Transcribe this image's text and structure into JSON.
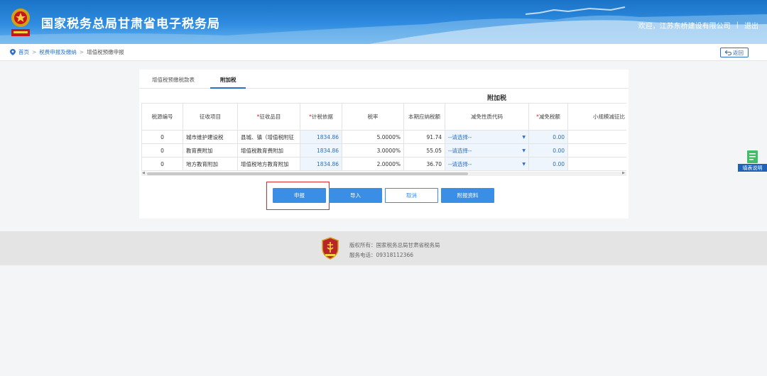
{
  "header": {
    "title": "国家税务总局甘肃省电子税务局",
    "welcome": "欢迎，江苏东桥建设有限公司",
    "separator": "|",
    "logout": "退出"
  },
  "breadcrumb": {
    "home": "首页",
    "level1": "税费申报及缴纳",
    "current": "增值税预缴申报",
    "back_label": "返回"
  },
  "tabs": [
    {
      "label": "增值税预缴税款表",
      "active": false
    },
    {
      "label": "附加税",
      "active": true
    }
  ],
  "table": {
    "group_title": "附加税",
    "columns": [
      "税源编号",
      "征收项目",
      "征收品目",
      "计税依据",
      "税率",
      "本期应纳税额",
      "减免性质代码",
      "减免税额",
      "小规模减征比"
    ],
    "required_mark": "*",
    "rows": [
      {
        "source_no": "0",
        "item": "城市维护建设税",
        "sub_item": "县城、镇（增值税附征",
        "basis": "1834.86",
        "rate": "5.0000%",
        "payable": "91.74",
        "relief_code": "--请选择--",
        "relief_amount": "0.00"
      },
      {
        "source_no": "0",
        "item": "教育费附加",
        "sub_item": "增值税教育费附加",
        "basis": "1834.86",
        "rate": "3.0000%",
        "payable": "55.05",
        "relief_code": "--请选择--",
        "relief_amount": "0.00"
      },
      {
        "source_no": "0",
        "item": "地方教育附加",
        "sub_item": "增值税地方教育附加",
        "basis": "1834.86",
        "rate": "2.0000%",
        "payable": "36.70",
        "relief_code": "--请选择--",
        "relief_amount": "0.00"
      }
    ]
  },
  "buttons": {
    "submit": "申报",
    "import": "导入",
    "cancel": "取消",
    "attach": "附报资料"
  },
  "side_help": {
    "label": "填表说明"
  },
  "footer": {
    "copyright": "版权所有：国家税务总局甘肃省税务局",
    "phone": "服务电话：09318112366"
  },
  "colors": {
    "primary": "#3a8ee6",
    "header": "#1a73c7",
    "highlight": "#e02a2a",
    "required": "#e02020"
  }
}
